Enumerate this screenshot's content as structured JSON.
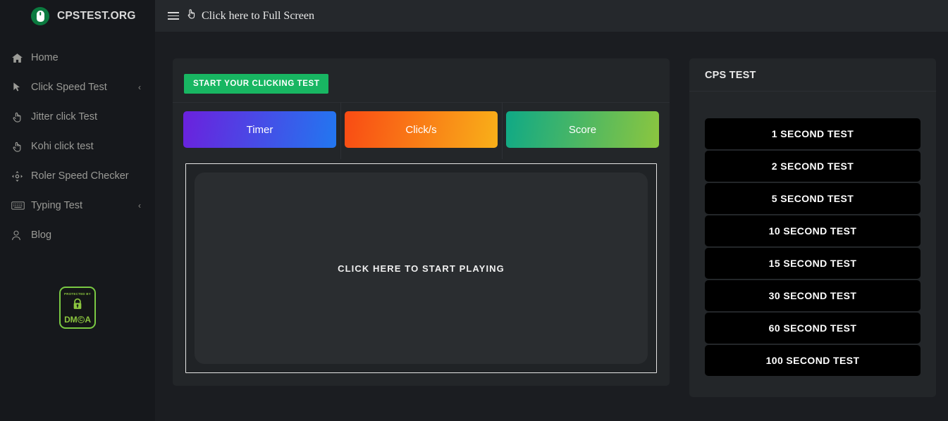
{
  "brand": {
    "name": "CPSTEST.ORG",
    "logo_icon": "mouse-icon"
  },
  "sidebar": {
    "items": [
      {
        "label": "Home",
        "icon": "home-icon",
        "chevron": ""
      },
      {
        "label": "Click Speed Test",
        "icon": "cursor-arrow-icon",
        "chevron": "‹"
      },
      {
        "label": "Jitter click Test",
        "icon": "pointing-hand-icon",
        "chevron": ""
      },
      {
        "label": "Kohi click test",
        "icon": "pointing-hand-icon",
        "chevron": ""
      },
      {
        "label": "Roler Speed Checker",
        "icon": "crosshair-arrows-icon",
        "chevron": ""
      },
      {
        "label": "Typing Test",
        "icon": "keyboard-icon",
        "chevron": "‹"
      },
      {
        "label": "Blog",
        "icon": "user-icon",
        "chevron": ""
      }
    ],
    "dmca": {
      "top_text": "PROTECTED BY",
      "word_prefix": "DM",
      "word_c": "C",
      "word_suffix": "A",
      "lock_icon": "lock-icon",
      "accent_color": "#8cc63f"
    }
  },
  "topbar": {
    "menu_icon": "hamburger-menu-icon",
    "fullscreen_icon": "expand-hand-icon",
    "fullscreen_label": "Click here to Full Screen"
  },
  "game": {
    "start_badge": "START YOUR CLICKING TEST",
    "stats": [
      {
        "label": "Timer",
        "gradient_from": "#6b21dd",
        "gradient_to": "#2277f0"
      },
      {
        "label": "Click/s",
        "gradient_from": "#f94b14",
        "gradient_to": "#f9b019"
      },
      {
        "label": "Score",
        "gradient_from": "#0fa986",
        "gradient_to": "#8cc63f"
      }
    ],
    "play_area_text": "CLICK HERE TO START PLAYING"
  },
  "cps_panel": {
    "title": "CPS TEST",
    "buttons": [
      {
        "label": "1 SECOND TEST"
      },
      {
        "label": "2 SECOND TEST"
      },
      {
        "label": "5 SECOND TEST"
      },
      {
        "label": "10 SECOND TEST"
      },
      {
        "label": "15 SECOND TEST"
      },
      {
        "label": "30 SECOND TEST"
      },
      {
        "label": "60 SECOND TEST"
      },
      {
        "label": "100 SECOND TEST"
      }
    ]
  }
}
